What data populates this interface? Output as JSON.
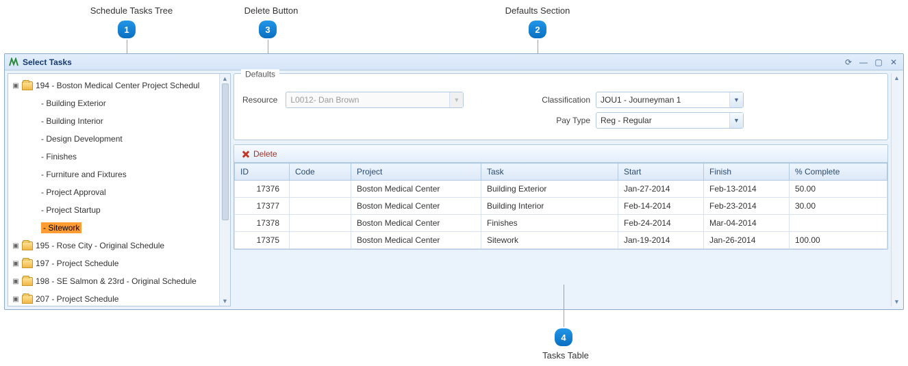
{
  "callouts": {
    "c1": {
      "label": "Schedule Tasks Tree",
      "num": "1"
    },
    "c2": {
      "label": "Defaults Section",
      "num": "2"
    },
    "c3": {
      "label": "Delete Button",
      "num": "3"
    },
    "c4": {
      "label": "Tasks Table",
      "num": "4"
    }
  },
  "window": {
    "title": "Select Tasks"
  },
  "tree": {
    "roots": [
      {
        "label": "194 - Boston Medical Center Project Schedul",
        "expanded": true,
        "children": [
          {
            "label": "Building Exterior"
          },
          {
            "label": "Building Interior"
          },
          {
            "label": "Design Development"
          },
          {
            "label": "Finishes"
          },
          {
            "label": "Furniture and Fixtures"
          },
          {
            "label": "Project Approval"
          },
          {
            "label": "Project Startup"
          },
          {
            "label": "Sitework",
            "selected": true
          }
        ]
      },
      {
        "label": "195 - Rose City - Original Schedule",
        "expanded": false
      },
      {
        "label": "197 - Project Schedule",
        "expanded": false
      },
      {
        "label": "198 - SE Salmon & 23rd - Original Schedule",
        "expanded": false
      },
      {
        "label": "207 - Project Schedule",
        "expanded": false
      }
    ]
  },
  "defaults": {
    "legend": "Defaults",
    "resource_label": "Resource",
    "resource_value": "L0012- Dan Brown",
    "classification_label": "Classification",
    "classification_value": "JOU1 - Journeyman 1",
    "paytype_label": "Pay Type",
    "paytype_value": "Reg - Regular"
  },
  "toolbar": {
    "delete_label": "Delete"
  },
  "grid": {
    "columns": [
      "ID",
      "Code",
      "Project",
      "Task",
      "Start",
      "Finish",
      "% Complete"
    ],
    "rows": [
      {
        "id": "17376",
        "code": "",
        "project": "Boston Medical Center",
        "task": "Building Exterior",
        "start": "Jan-27-2014",
        "finish": "Feb-13-2014",
        "pct": "50.00"
      },
      {
        "id": "17377",
        "code": "",
        "project": "Boston Medical Center",
        "task": "Building Interior",
        "start": "Feb-14-2014",
        "finish": "Feb-23-2014",
        "pct": "30.00"
      },
      {
        "id": "17378",
        "code": "",
        "project": "Boston Medical Center",
        "task": "Finishes",
        "start": "Feb-24-2014",
        "finish": "Mar-04-2014",
        "pct": ""
      },
      {
        "id": "17375",
        "code": "",
        "project": "Boston Medical Center",
        "task": "Sitework",
        "start": "Jan-19-2014",
        "finish": "Jan-26-2014",
        "pct": "100.00"
      }
    ]
  }
}
